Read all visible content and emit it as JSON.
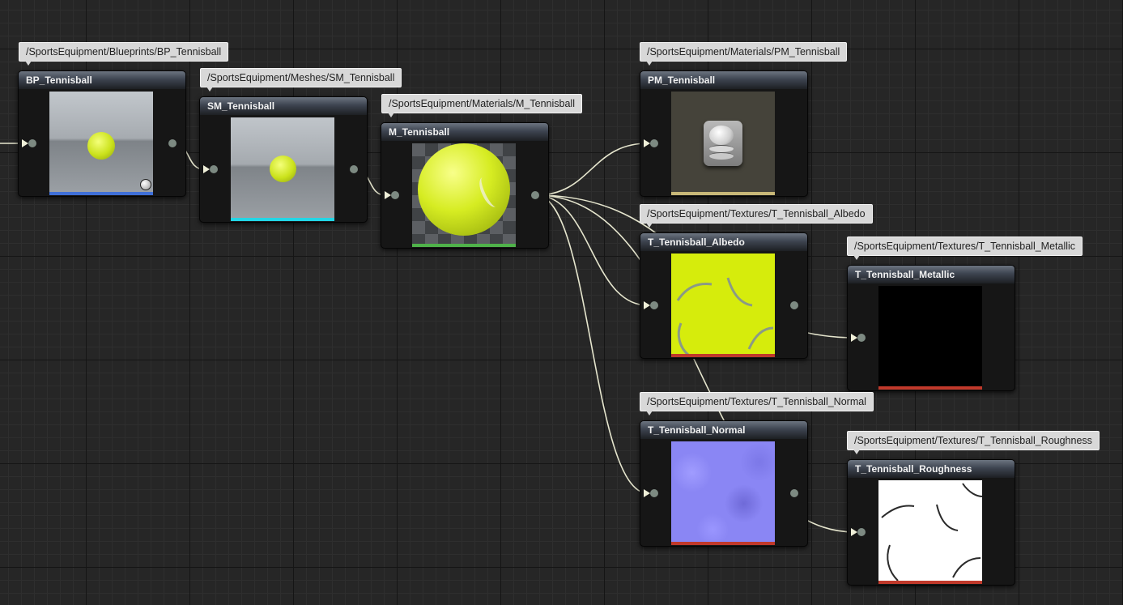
{
  "graph": {
    "wire_color": "#e8e8d0",
    "nodes": [
      {
        "id": "bp",
        "title": "BP_Tennisball",
        "path": "/SportsEquipment/Blueprints/BP_Tennisball",
        "bar_color": "#3f6fd8",
        "thumbnail": "blueprint-preview-icon"
      },
      {
        "id": "sm",
        "title": "SM_Tennisball",
        "path": "/SportsEquipment/Meshes/SM_Tennisball",
        "bar_color": "#22d6e6",
        "thumbnail": "static-mesh-preview-icon"
      },
      {
        "id": "m",
        "title": "M_Tennisball",
        "path": "/SportsEquipment/Materials/M_Tennisball",
        "bar_color": "#4fb24a",
        "thumbnail": "material-sphere-preview-icon"
      },
      {
        "id": "pm",
        "title": "PM_Tennisball",
        "path": "/SportsEquipment/Materials/PM_Tennisball",
        "bar_color": "#c8b878",
        "thumbnail": "physical-material-icon"
      },
      {
        "id": "albedo",
        "title": "T_Tennisball_Albedo",
        "path": "/SportsEquipment/Textures/T_Tennisball_Albedo",
        "bar_color": "#c0392b",
        "thumbnail": "albedo-texture-preview"
      },
      {
        "id": "metallic",
        "title": "T_Tennisball_Metallic",
        "path": "/SportsEquipment/Textures/T_Tennisball_Metallic",
        "bar_color": "#c0392b",
        "thumbnail": "metallic-texture-preview"
      },
      {
        "id": "normal",
        "title": "T_Tennisball_Normal",
        "path": "/SportsEquipment/Textures/T_Tennisball_Normal",
        "bar_color": "#c0392b",
        "thumbnail": "normal-texture-preview"
      },
      {
        "id": "roughness",
        "title": "T_Tennisball_Roughness",
        "path": "/SportsEquipment/Textures/T_Tennisball_Roughness",
        "bar_color": "#c0392b",
        "thumbnail": "roughness-texture-preview"
      }
    ],
    "links": [
      {
        "from": "bp",
        "to": "sm"
      },
      {
        "from": "sm",
        "to": "m"
      },
      {
        "from": "m",
        "to": "pm"
      },
      {
        "from": "m",
        "to": "albedo"
      },
      {
        "from": "m",
        "to": "metallic"
      },
      {
        "from": "m",
        "to": "normal"
      },
      {
        "from": "m",
        "to": "roughness"
      }
    ]
  }
}
